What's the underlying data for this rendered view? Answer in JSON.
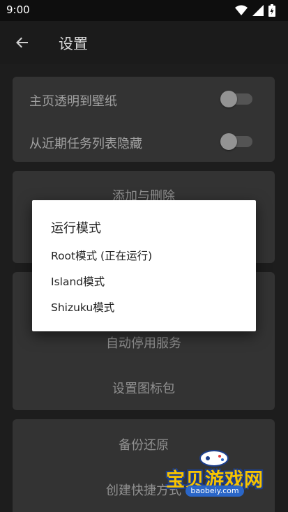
{
  "status_bar": {
    "time": "9:00",
    "icons": [
      "wifi-icon",
      "signal-icon",
      "battery-icon"
    ]
  },
  "app_bar": {
    "title": "设置",
    "back_icon": "arrow-back-icon"
  },
  "settings": {
    "toggles": [
      {
        "label": "主页透明到壁纸",
        "on": false
      },
      {
        "label": "从近期任务列表隐藏",
        "on": false
      }
    ],
    "card2": {
      "item1": "添加与删除"
    },
    "card3": {
      "item1": "自动停用服务",
      "item2": "设置图标包"
    },
    "card4": {
      "item1": "备份还原",
      "item2": "创建快捷方式"
    }
  },
  "dialog": {
    "title": "运行模式",
    "options": [
      "Root模式 (正在运行)",
      "Island模式",
      "Shizuku模式"
    ]
  },
  "watermark": {
    "text": "宝贝游戏网",
    "url": "baobeiy.com"
  },
  "colors": {
    "background": "#262626",
    "card": "#424242",
    "dialog": "#ffffff",
    "watermark_yellow": "#f7c300",
    "watermark_blue": "#2a66c8"
  }
}
